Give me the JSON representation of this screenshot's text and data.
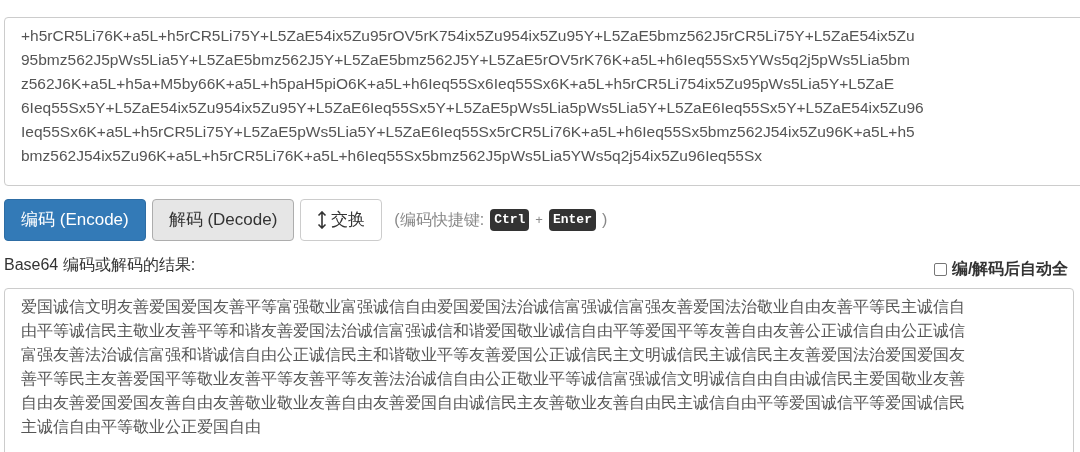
{
  "input_box": {
    "lines": [
      "+h5rCR5Li76K+a5L+h5rCR5Li75Y+L5ZaE54ix5Zu95rOV5rK754ix5Zu954ix5Zu95Y+L5ZaE5bmz562J5rCR5Li75Y+L5ZaE54ix5Zu",
      "95bmz562J5pWs5Lia5Y+L5ZaE5bmz562J5Y+L5ZaE5bmz562J5Y+L5ZaE5rOV5rK76K+a5L+h6Ieq55Sx5YWs5q2j5pWs5Lia5bm",
      "z562J6K+a5L+h5a+M5by66K+a5L+h5paH5piO6K+a5L+h6Ieq55Sx6Ieq55Sx6K+a5L+h5rCR5Li754ix5Zu95pWs5Lia5Y+L5ZaE",
      "6Ieq55Sx5Y+L5ZaE54ix5Zu954ix5Zu95Y+L5ZaE6Ieq55Sx5Y+L5ZaE5pWs5Lia5pWs5Lia5Y+L5ZaE6Ieq55Sx5Y+L5ZaE54ix5Zu96",
      "Ieq55Sx6K+a5L+h5rCR5Li75Y+L5ZaE5pWs5Lia5Y+L5ZaE6Ieq55Sx5rCR5Li76K+a5L+h6Ieq55Sx5bmz562J54ix5Zu96K+a5L+h5",
      "bmz562J54ix5Zu96K+a5L+h5rCR5Li76K+a5L+h6Ieq55Sx5bmz562J5pWs5Lia5YWs5q2j54ix5Zu96Ieq55Sx"
    ]
  },
  "buttons": [
    {
      "label": "编码 (Encode)",
      "kind": "primary"
    },
    {
      "label": "解码 (Decode)",
      "kind": "default"
    },
    {
      "label": "交换",
      "kind": "swap"
    }
  ],
  "shortcut": {
    "prefix": "(编码快捷键:",
    "keys": [
      "Ctrl",
      "Enter"
    ],
    "plus": "+",
    "suffix": ")"
  },
  "result_label": "Base64 编码或解码的结果:",
  "auto_option": {
    "label": "编/解码后自动全",
    "checked": false
  },
  "result_box": {
    "lines": [
      "爱国诚信文明友善爱国爱国友善平等富强敬业富强诚信自由爱国爱国法治诚信富强诚信富强友善爱国法治敬业自由友善平等民主诚信自",
      "由平等诚信民主敬业友善平等和谐友善爱国法治诚信富强诚信和谐爱国敬业诚信自由平等爱国平等友善自由友善公正诚信自由公正诚信",
      "富强友善法治诚信富强和谐诚信自由公正诚信民主和谐敬业平等友善爱国公正诚信民主文明诚信民主诚信民主友善爱国法治爱国爱国友",
      "善平等民主友善爱国平等敬业友善平等友善平等友善法治诚信自由公正敬业平等诚信富强诚信文明诚信自由自由诚信民主爱国敬业友善",
      "自由友善爱国爱国友善自由友善敬业敬业友善自由友善爱国自由诚信民主友善敬业友善自由民主诚信自由平等爱国诚信平等爱国诚信民",
      "主诚信自由平等敬业公正爱国自由"
    ]
  }
}
